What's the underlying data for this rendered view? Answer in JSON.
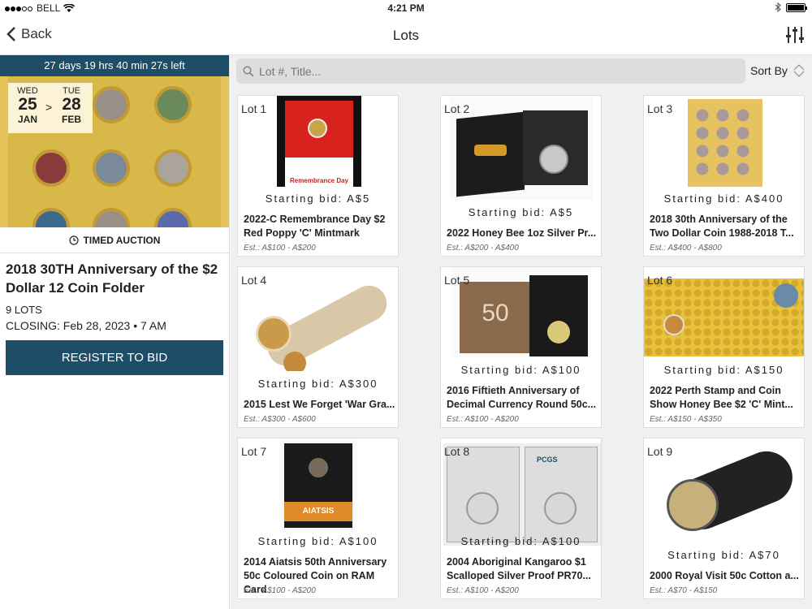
{
  "status": {
    "carrier": "BELL",
    "time": "4:21 PM"
  },
  "nav": {
    "back_label": "Back",
    "title": "Lots"
  },
  "auction": {
    "countdown": "27 days 19 hrs 40 min 27s left",
    "start": {
      "day": "WED",
      "date": "25",
      "month": "JAN"
    },
    "end": {
      "day": "TUE",
      "date": "28",
      "month": "FEB"
    },
    "arrow": ">",
    "type": "TIMED AUCTION",
    "title": "2018 30TH Anniversary of the $2 Dollar 12 Coin Folder",
    "lots": "9 LOTS",
    "closing": "CLOSING: Feb 28, 2023 • 7 AM",
    "register_label": "REGISTER TO BID"
  },
  "search": {
    "placeholder": "Lot #, Title..."
  },
  "sort_label": "Sort By",
  "lots": [
    {
      "lot": "Lot 1",
      "bid": "Starting bid: A$5",
      "title": "2022-C Remembrance Day $2 Red Poppy 'C' Mintmark",
      "est": "Est.: A$100 - A$200"
    },
    {
      "lot": "Lot 2",
      "bid": "Starting bid: A$5",
      "title": "2022 Honey Bee 1oz Silver Pr...",
      "est": "Est.: A$200 - A$400"
    },
    {
      "lot": "Lot 3",
      "bid": "Starting bid: A$400",
      "title": "2018 30th Anniversary of the Two Dollar Coin 1988-2018 T...",
      "est": "Est.: A$400 - A$800"
    },
    {
      "lot": "Lot 4",
      "bid": "Starting bid: A$300",
      "title": "2015 Lest We Forget 'War Gra...",
      "est": "Est.: A$300 - A$600"
    },
    {
      "lot": "Lot 5",
      "bid": "Starting bid: A$100",
      "title": "2016 Fiftieth Anniversary of Decimal Currency Round 50c...",
      "est": "Est.: A$100 - A$200"
    },
    {
      "lot": "Lot 6",
      "bid": "Starting bid: A$150",
      "title": "2022 Perth Stamp and Coin Show Honey Bee $2 'C' Mint...",
      "est": "Est.: A$150 - A$350"
    },
    {
      "lot": "Lot 7",
      "bid": "Starting bid: A$100",
      "title": "2014 Aiatsis 50th Anniversary 50c Coloured Coin on RAM Card",
      "est": "Est.: A$100 - A$200"
    },
    {
      "lot": "Lot 8",
      "bid": "Starting bid: A$100",
      "title": "2004 Aboriginal Kangaroo $1 Scalloped Silver Proof PR70...",
      "est": "Est.: A$100 - A$200"
    },
    {
      "lot": "Lot 9",
      "bid": "Starting bid: A$70",
      "title": "2000 Royal Visit 50c Cotton a...",
      "est": "Est.: A$70 - A$150"
    }
  ],
  "image_text": {
    "lot1": "Remembrance Day",
    "lot5": "50",
    "lot7": "AIATSIS",
    "lot8": "PCGS"
  },
  "colors": {
    "accent": "#1e4d68",
    "background": "#f0f0f0"
  }
}
